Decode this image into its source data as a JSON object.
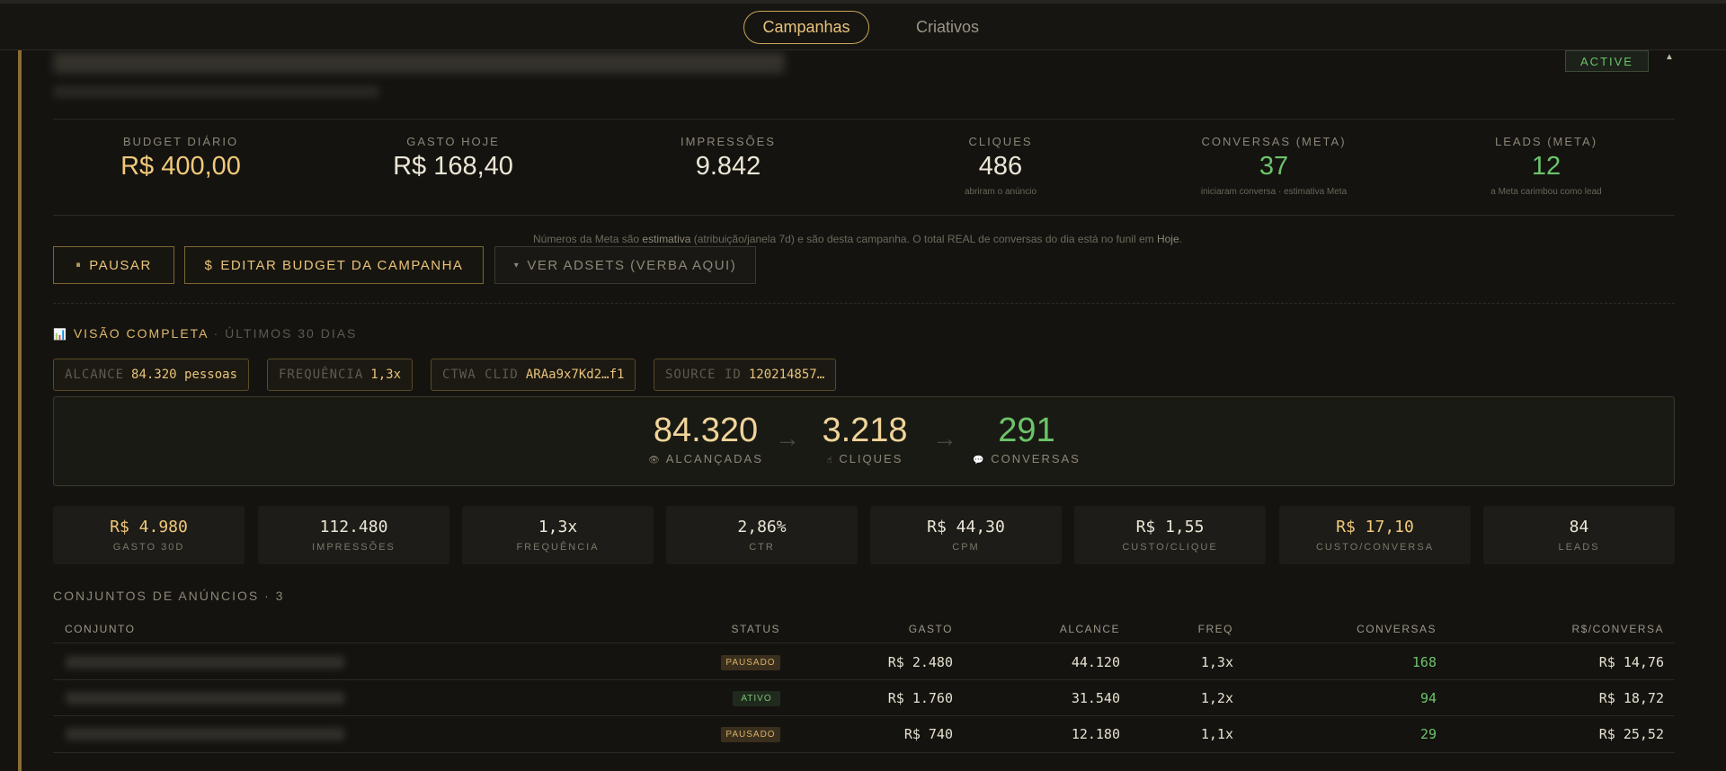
{
  "nav": {
    "tabs": [
      {
        "label": "Campanhas",
        "active": true
      },
      {
        "label": "Criativos",
        "active": false
      }
    ]
  },
  "campaign": {
    "status": "ACTIVE",
    "collapse_glyph": "▲"
  },
  "kpis": [
    {
      "label": "BUDGET DIÁRIO",
      "value": "R$ 400,00",
      "sub": "",
      "color": "#f0c97a"
    },
    {
      "label": "GASTO HOJE",
      "value": "R$ 168,40",
      "sub": "",
      "color": "#ece6d6"
    },
    {
      "label": "IMPRESSÕES",
      "value": "9.842",
      "sub": "",
      "color": "#ece6d6"
    },
    {
      "label": "CLIQUES",
      "value": "486",
      "sub": "abriram o anúncio",
      "color": "#ece6d6"
    },
    {
      "label": "CONVERSAS (META)",
      "value": "37",
      "sub": "iniciaram conversa · estimativa Meta",
      "color": "#6cc46a"
    },
    {
      "label": "LEADS (META)",
      "value": "12",
      "sub": "a Meta carimbou como lead",
      "color": "#6cc46a"
    }
  ],
  "disclaimer": {
    "p1": "Números da Meta são ",
    "b1": "estimativa",
    "p2": " (atribuição/janela 7d) e são desta campanha. O total REAL de conversas do dia está no funil em ",
    "b2": "Hoje",
    "p3": "."
  },
  "actions": {
    "pause": {
      "icon": "⏸",
      "label": "PAUSAR"
    },
    "edit_budget": {
      "icon": "$",
      "label": "EDITAR BUDGET DA CAMPANHA"
    },
    "view_adsets": {
      "icon": "▾",
      "label": "VER ADSETS (VERBA AQUI)"
    }
  },
  "overview": {
    "icon": "📊",
    "title": "VISÃO COMPLETA",
    "period": " · ÚLTIMOS 30 DIAS",
    "chips": [
      {
        "key": "ALCANCE",
        "value": "84.320 pessoas"
      },
      {
        "key": "FREQUÊNCIA",
        "value": "1,3x"
      },
      {
        "key": "CTWA CLID",
        "value": "ARAa9x7Kd2…f1"
      },
      {
        "key": "SOURCE ID",
        "value": "120214857…"
      }
    ]
  },
  "funnel": {
    "reach": {
      "value": "84.320",
      "icon": "👁",
      "label": "ALCANÇADAS",
      "color": "#f0d49a"
    },
    "clicks": {
      "value": "3.218",
      "icon": "☝",
      "label": "CLIQUES",
      "color": "#f0d49a"
    },
    "conversations": {
      "value": "291",
      "icon": "💬",
      "label": "CONVERSAS",
      "color": "#6cc46a"
    },
    "arrow": "→"
  },
  "metrics": [
    {
      "value": "R$ 4.980",
      "label": "GASTO 30D",
      "color": "#f0c97a"
    },
    {
      "value": "112.480",
      "label": "IMPRESSÕES",
      "color": "#ece6d6"
    },
    {
      "value": "1,3x",
      "label": "FREQUÊNCIA",
      "color": "#ece6d6"
    },
    {
      "value": "2,86%",
      "label": "CTR",
      "color": "#ece6d6"
    },
    {
      "value": "R$ 44,30",
      "label": "CPM",
      "color": "#ece6d6"
    },
    {
      "value": "R$ 1,55",
      "label": "CUSTO/CLIQUE",
      "color": "#ece6d6"
    },
    {
      "value": "R$ 17,10",
      "label": "CUSTO/CONVERSA",
      "color": "#f0c97a"
    },
    {
      "value": "84",
      "label": "LEADS",
      "color": "#ece6d6"
    }
  ],
  "adsets": {
    "title": "CONJUNTOS DE ANÚNCIOS · 3",
    "columns": [
      "CONJUNTO",
      "STATUS",
      "GASTO",
      "ALCANCE",
      "FREQ",
      "CONVERSAS",
      "R$/CONVERSA"
    ],
    "rows": [
      {
        "status": "PAUSADO",
        "spend": "R$ 2.480",
        "reach": "44.120",
        "freq": "1,3x",
        "conversations": "168",
        "cost_per_conv": "R$ 14,76"
      },
      {
        "status": "ATIVO",
        "spend": "R$ 1.760",
        "reach": "31.540",
        "freq": "1,2x",
        "conversations": "94",
        "cost_per_conv": "R$ 18,72"
      },
      {
        "status": "PAUSADO",
        "spend": "R$ 740",
        "reach": "12.180",
        "freq": "1,1x",
        "conversations": "29",
        "cost_per_conv": "R$ 25,52"
      }
    ]
  }
}
